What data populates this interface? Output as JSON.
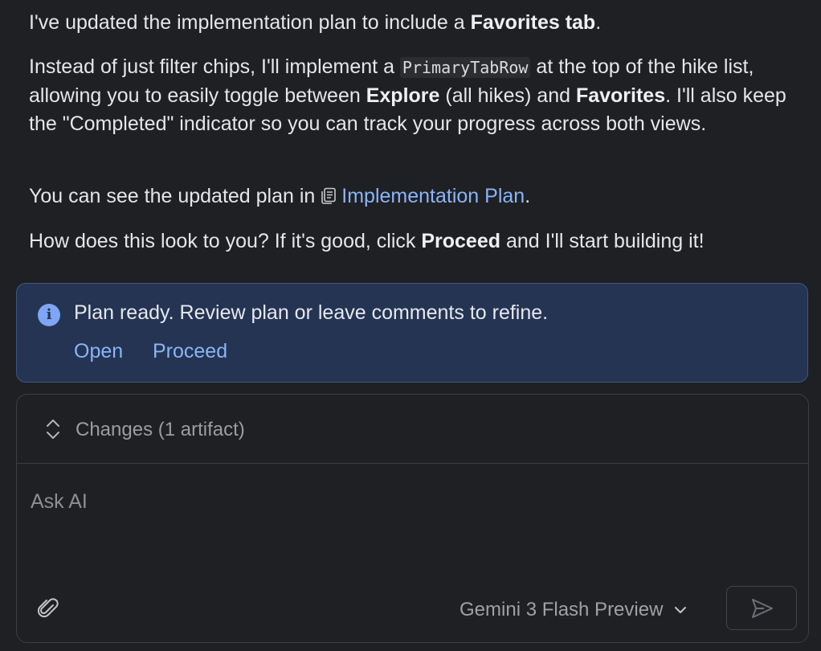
{
  "message": {
    "p1": {
      "text1": "I've updated the implementation plan to include a ",
      "bold1": "Favorites tab",
      "text2": "."
    },
    "p2": {
      "text1": "Instead of just filter chips, I'll implement a ",
      "code1": "PrimaryTabRow",
      "text2": " at the top of the hike list, allowing you to easily toggle between ",
      "bold1": "Explore",
      "text3": " (all hikes) and ",
      "bold2": "Favorites",
      "text4": ". I'll also keep the \"Completed\" indicator so you can track your progress across both views."
    },
    "p3": {
      "text1": "You can see the updated plan in ",
      "icon": "document-icon",
      "link": "Implementation Plan",
      "text2": "."
    },
    "p4": {
      "text1": "How does this look to you? If it's good, click ",
      "bold1": "Proceed",
      "text2": " and I'll start building it!"
    }
  },
  "banner": {
    "icon": "info-icon",
    "message": "Plan ready. Review plan or leave comments to refine.",
    "open_label": "Open",
    "proceed_label": "Proceed"
  },
  "composer": {
    "changes_label": "Changes (1 artifact)",
    "placeholder": "Ask AI",
    "model_label": "Gemini 3 Flash Preview",
    "attach_icon": "paperclip-icon",
    "send_icon": "send-icon"
  },
  "colors": {
    "background": "#1f2023",
    "link": "#8ab4f8",
    "banner_bg": "#243452",
    "banner_border": "#3c5585"
  }
}
